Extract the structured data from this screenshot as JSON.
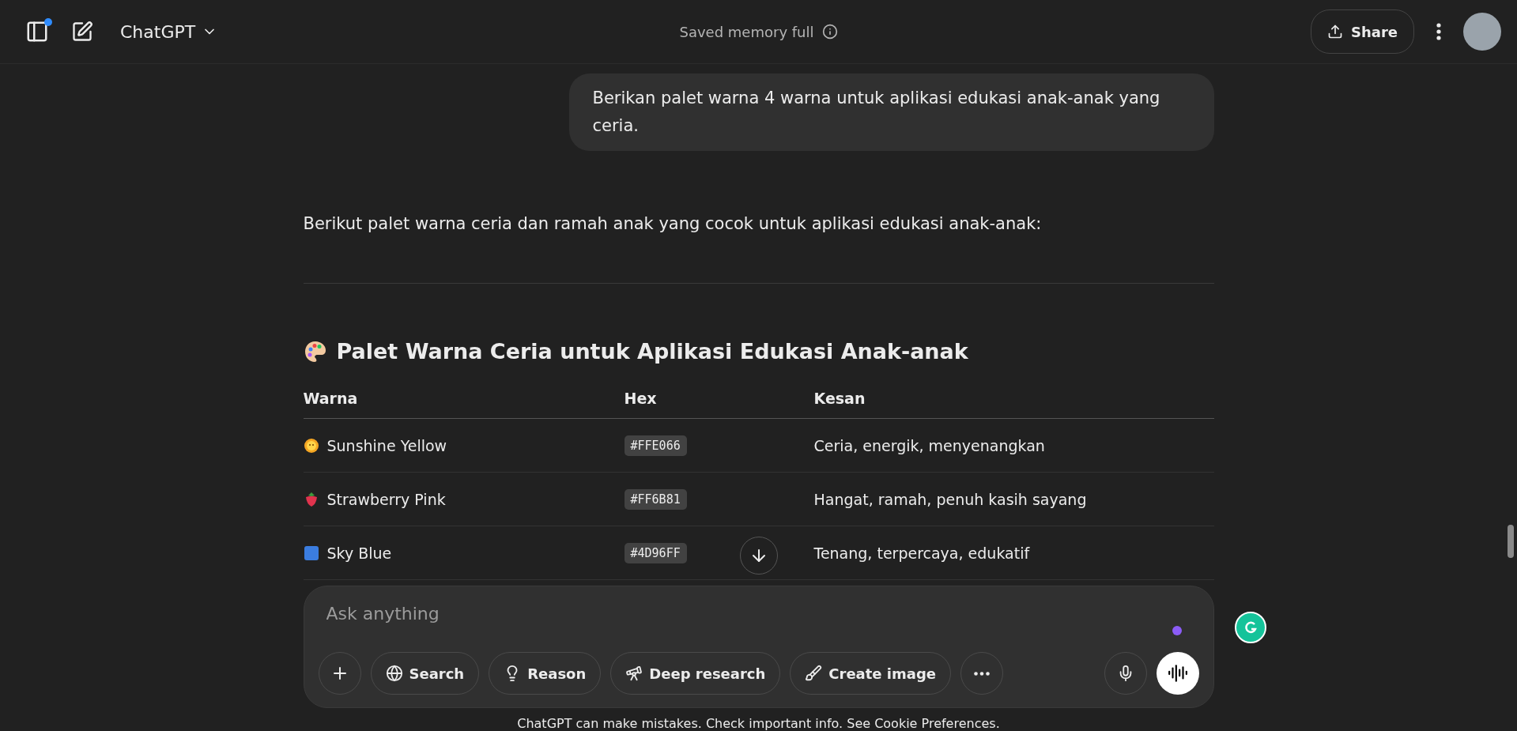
{
  "header": {
    "title": "ChatGPT",
    "memory_status": "Saved memory full",
    "share_label": "Share",
    "sidebar_notification": true
  },
  "user_message": "Berikan palet warna 4 warna untuk aplikasi edukasi anak-anak yang ceria.",
  "assistant": {
    "intro": "Berikut palet warna ceria dan ramah anak yang cocok untuk aplikasi edukasi anak-anak:",
    "heading": "Palet Warna Ceria untuk Aplikasi Edukasi Anak-anak",
    "table": {
      "columns": [
        "Warna",
        "Hex",
        "Kesan"
      ],
      "rows": [
        {
          "name": "Sunshine Yellow",
          "hex": "#FFE066",
          "impression": "Ceria, energik, menyenangkan"
        },
        {
          "name": "Strawberry Pink",
          "hex": "#FF6B81",
          "impression": "Hangat, ramah, penuh kasih sayang"
        },
        {
          "name": "Sky Blue",
          "hex": "#4D96FF",
          "impression": "Tenang, terpercaya, edukatif"
        }
      ]
    }
  },
  "composer": {
    "placeholder": "Ask anything",
    "tools": [
      {
        "kind": "globe",
        "label": "Search"
      },
      {
        "kind": "bulb",
        "label": "Reason"
      },
      {
        "kind": "telescope",
        "label": "Deep research"
      },
      {
        "kind": "brush",
        "label": "Create image"
      }
    ]
  },
  "footer": "ChatGPT can make mistakes. Check important info. See Cookie Preferences."
}
